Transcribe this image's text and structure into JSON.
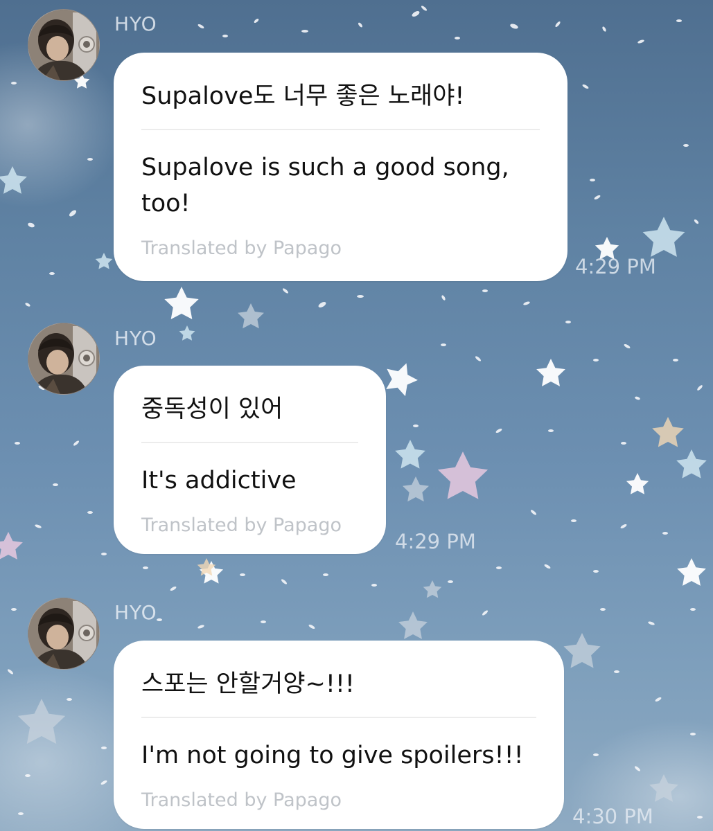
{
  "theme": {
    "bubble_color": "#ffffff",
    "credit_color": "#bfc3c8",
    "name_color": "#e3e9f0",
    "wallpaper_top": "#4f6f90",
    "wallpaper_bottom": "#8eaac2"
  },
  "messages": [
    {
      "sender": "HYO",
      "original": "Supalove도 너무 좋은 노래야!",
      "translation": "Supalove is such a good song, too!",
      "credit": "Translated by Papago",
      "time": "4:29 PM"
    },
    {
      "sender": "HYO",
      "original": "중독성이 있어",
      "translation": "It's addictive",
      "credit": "Translated by Papago",
      "time": "4:29 PM"
    },
    {
      "sender": "HYO",
      "original": "스포는 안할거양~!!!",
      "translation": "I'm not going to give spoilers!!!",
      "credit": "Translated by Papago",
      "time": "4:30 PM"
    }
  ]
}
